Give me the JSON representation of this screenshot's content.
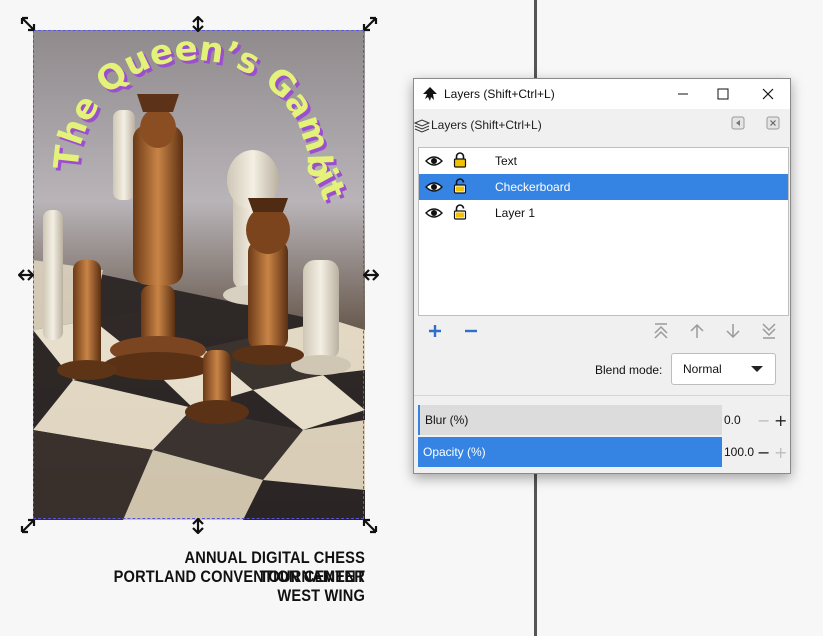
{
  "caption": {
    "line1": "ANNUAL DIGITAL CHESS TOURNAMENT",
    "line2": "PORTLAND CONVENTION CENTER",
    "line3": "WEST WING"
  },
  "artwork": {
    "title_text": "The Queen’s Gambit",
    "accent_color": "#e4f27a",
    "shadow_color": "#9b4fd0"
  },
  "dialog": {
    "window_title": "Layers (Shift+Ctrl+L)",
    "tab_label": "Layers (Shift+Ctrl+L)",
    "minimize_icon": "minimize-icon",
    "maximize_icon": "maximize-icon",
    "close_icon": "close-icon",
    "layers": [
      {
        "name": "Text",
        "visible": true,
        "locked": true,
        "selected": false
      },
      {
        "name": "Checkerboard",
        "visible": true,
        "locked": false,
        "selected": true
      },
      {
        "name": "Layer 1",
        "visible": true,
        "locked": false,
        "selected": false
      }
    ],
    "blend_mode_label": "Blend mode:",
    "blend_mode_value": "Normal",
    "blur_label": "Blur (%)",
    "blur_value": "0.0",
    "opacity_label": "Opacity (%)",
    "opacity_value": "100.0",
    "opacity_fraction": 1.0,
    "selection_color": "#3584e4"
  }
}
